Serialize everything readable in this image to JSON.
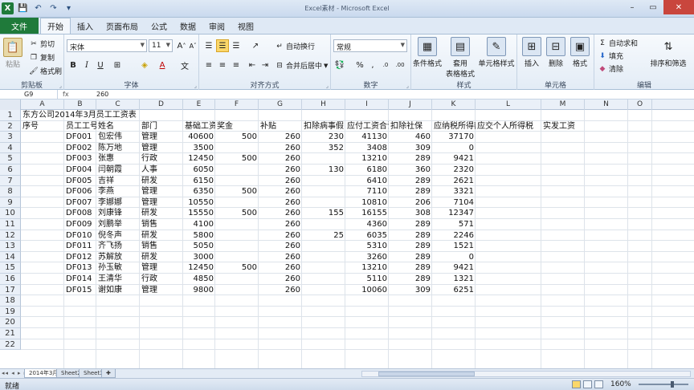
{
  "window": {
    "title": "Excel素材 - Microsoft Excel"
  },
  "tabs": [
    "文件",
    "开始",
    "插入",
    "页面布局",
    "公式",
    "数据",
    "审阅",
    "视图"
  ],
  "ribbon": {
    "clipboard": {
      "label": "剪贴板",
      "paste": "粘贴",
      "cut": "剪切",
      "copy": "复制",
      "format_painter": "格式刷"
    },
    "font": {
      "label": "字体",
      "name": "宋体",
      "size": "11"
    },
    "alignment": {
      "label": "对齐方式",
      "wrap": "自动换行",
      "merge": "合并后居中"
    },
    "number": {
      "label": "数字",
      "format": "常规"
    },
    "styles": {
      "label": "样式",
      "conditional": "条件格式",
      "table": "套用",
      "table2": "表格格式",
      "cell": "单元格样式"
    },
    "cells": {
      "label": "单元格",
      "insert": "插入",
      "delete": "删除",
      "format": "格式"
    },
    "editing": {
      "label": "编辑",
      "autosum": "自动求和",
      "fill": "填充",
      "clear": "清除",
      "sort": "排序和筛选"
    }
  },
  "formula_bar": {
    "name_box": "G9",
    "fx": "fx",
    "content": "260"
  },
  "columns": [
    "A",
    "B",
    "C",
    "D",
    "E",
    "F",
    "G",
    "H",
    "I",
    "J",
    "K",
    "L",
    "M",
    "N",
    "O"
  ],
  "rows": [
    "1",
    "2",
    "3",
    "4",
    "5",
    "6",
    "7",
    "8",
    "9",
    "10",
    "11",
    "12",
    "13",
    "14",
    "15",
    "16",
    "17",
    "18",
    "19",
    "20",
    "21",
    "22"
  ],
  "sheet": {
    "title": "东方公司2014年3月员工工资表",
    "headers": [
      "序号",
      "员工工号",
      "姓名",
      "部门",
      "基础工资",
      "奖金",
      "补贴",
      "扣除病事假",
      "应付工资合计",
      "扣除社保",
      "应纳税所得额",
      "应交个人所得税",
      "实发工资"
    ],
    "records": [
      [
        "DF001",
        "包宏伟",
        "管理",
        "40600",
        "500",
        "260",
        "230",
        "41130",
        "460",
        "37170"
      ],
      [
        "DF002",
        "陈万地",
        "管理",
        "3500",
        "",
        "260",
        "352",
        "3408",
        "309",
        "0"
      ],
      [
        "DF003",
        "张惠",
        "行政",
        "12450",
        "500",
        "260",
        "",
        "13210",
        "289",
        "9421"
      ],
      [
        "DF004",
        "闫朝霞",
        "人事",
        "6050",
        "",
        "260",
        "130",
        "6180",
        "360",
        "2320"
      ],
      [
        "DF005",
        "吉祥",
        "研发",
        "6150",
        "",
        "260",
        "",
        "6410",
        "289",
        "2621"
      ],
      [
        "DF006",
        "李燕",
        "管理",
        "6350",
        "500",
        "260",
        "",
        "7110",
        "289",
        "3321"
      ],
      [
        "DF007",
        "李娜娜",
        "管理",
        "10550",
        "",
        "260",
        "",
        "10810",
        "206",
        "7104"
      ],
      [
        "DF008",
        "刘康锋",
        "研发",
        "15550",
        "500",
        "260",
        "155",
        "16155",
        "308",
        "12347"
      ],
      [
        "DF009",
        "刘鹏举",
        "销售",
        "4100",
        "",
        "260",
        "",
        "4360",
        "289",
        "571"
      ],
      [
        "DF010",
        "倪冬声",
        "研发",
        "5800",
        "",
        "260",
        "25",
        "6035",
        "289",
        "2246"
      ],
      [
        "DF011",
        "齐飞扬",
        "销售",
        "5050",
        "",
        "260",
        "",
        "5310",
        "289",
        "1521"
      ],
      [
        "DF012",
        "苏解放",
        "研发",
        "3000",
        "",
        "260",
        "",
        "3260",
        "289",
        "0"
      ],
      [
        "DF013",
        "孙玉敏",
        "管理",
        "12450",
        "500",
        "260",
        "",
        "13210",
        "289",
        "9421"
      ],
      [
        "DF014",
        "王清华",
        "行政",
        "4850",
        "",
        "260",
        "",
        "5110",
        "289",
        "1321"
      ],
      [
        "DF015",
        "谢如康",
        "管理",
        "9800",
        "",
        "260",
        "",
        "10060",
        "309",
        "6251"
      ]
    ]
  },
  "sheet_tabs": [
    "2014年3月",
    "Sheet2",
    "Sheet3"
  ],
  "status": {
    "ready": "就绪",
    "zoom": "160%"
  }
}
